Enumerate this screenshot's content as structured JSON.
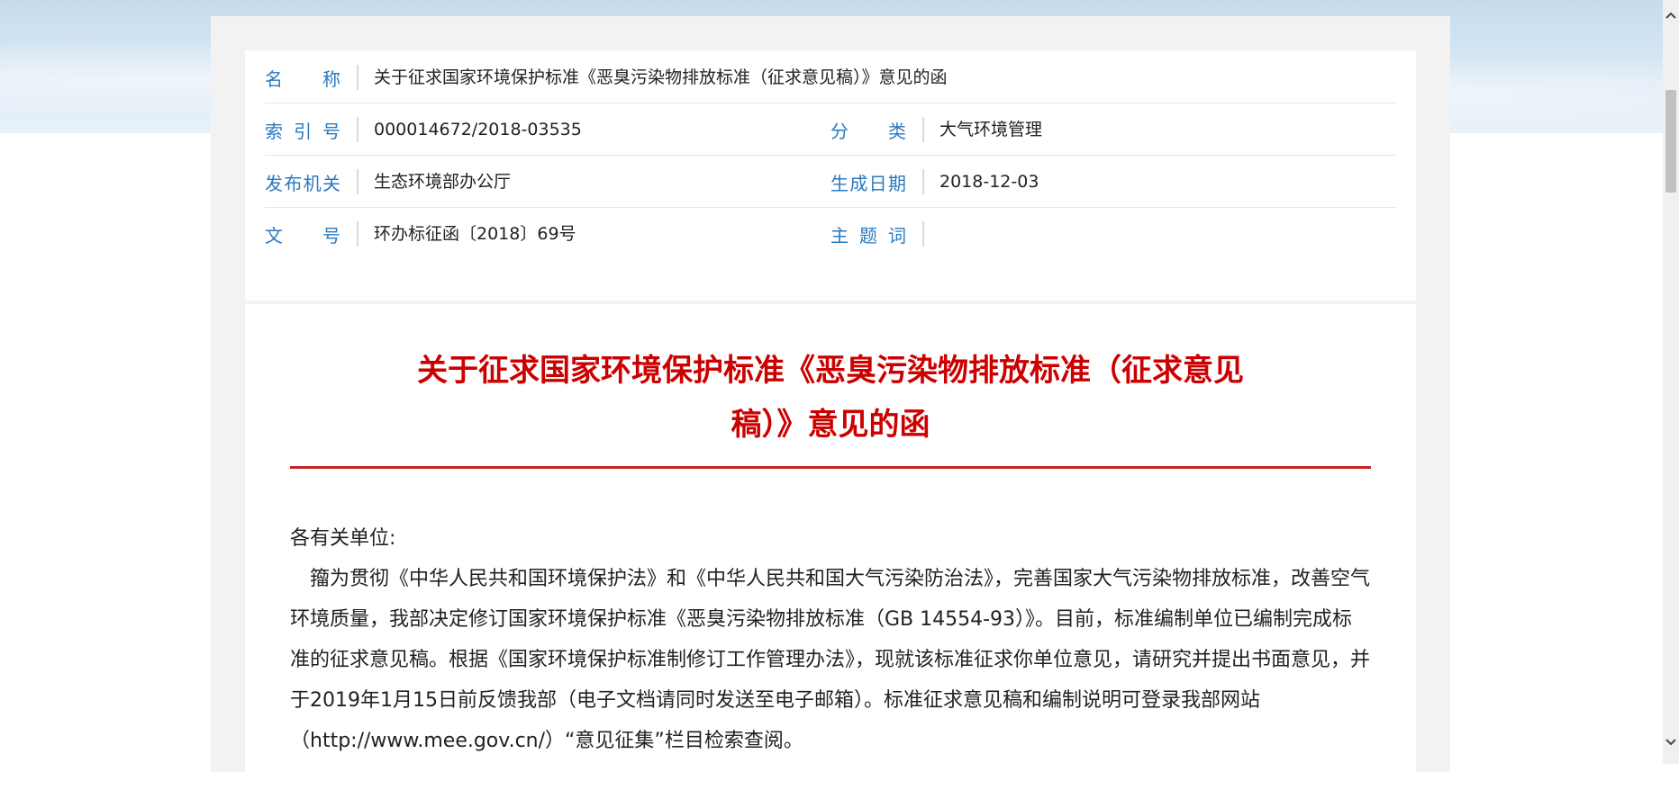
{
  "meta": {
    "rows": [
      {
        "label": "名　称",
        "value": "关于征求国家环境保护标准《恶臭污染物排放标准（征求意见稿）》意见的函"
      },
      {
        "label": "索引号",
        "value": "000014672/2018-03535",
        "label2": "分　类",
        "value2": "大气环境管理"
      },
      {
        "label": "发布机关",
        "value": "生态环境部办公厅",
        "label2": "生成日期",
        "value2": "2018-12-03"
      },
      {
        "label": "文　号",
        "value": "环办标征函〔2018〕69号",
        "label2": "主题词",
        "value2": ""
      }
    ]
  },
  "document": {
    "title_line1": "关于征求国家环境保护标准《恶臭污染物排放标准（征求意见",
    "title_line2": "稿）》意见的函",
    "salutation": "各有关单位:",
    "paragraph": "籀为贯彻《中华人民共和国环境保护法》和《中华人民共和国大气污染防治法》，完善国家大气污染物排放标准，改善空气环境质量，我部决定修订国家环境保护标准《恶臭污染物排放标准（GB 14554-93）》。目前，标准编制单位已编制完成标准的征求意见稿。根据《国家环境保护标准制修订工作管理办法》，现就该标准征求你单位意见，请研究并提出书面意见，并于2019年1月15日前反馈我部（电子文档请同时发送至电子邮箱）。标准征求意见稿和编制说明可登录我部网站（http://www.mee.gov.cn/）“意见征集”栏目检索查阅。"
  },
  "colors": {
    "label_blue": "#2a7ac0",
    "title_red": "#cc0000"
  },
  "scrollbar": {
    "up_icon": "chevron-up-icon",
    "down_icon": "chevron-down-icon"
  }
}
